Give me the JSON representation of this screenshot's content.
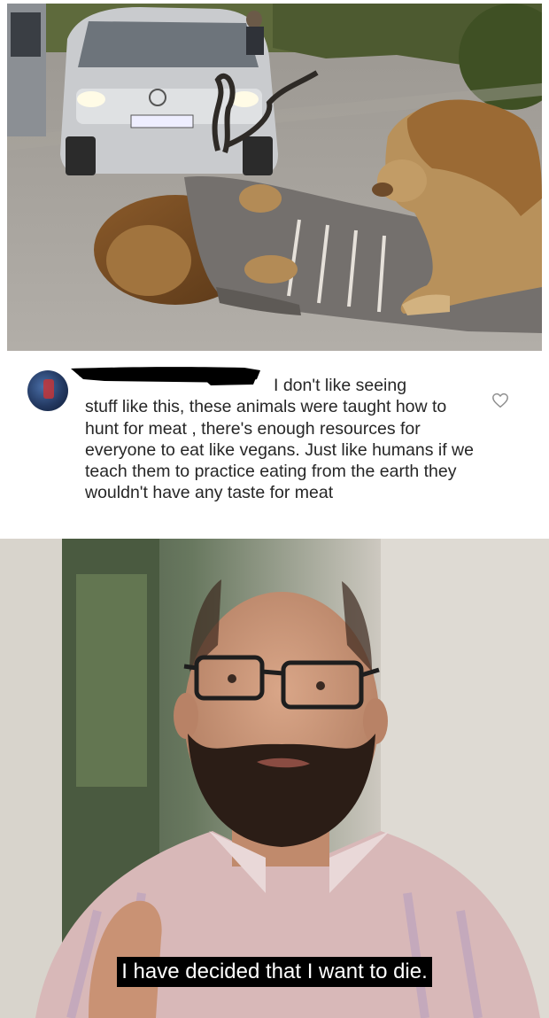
{
  "comment": {
    "text_line1": "I don't like seeing",
    "text_rest": "stuff like this, these animals were taught how to hunt for meat , there's enough resources for everyone to eat like vegans. Just like humans if we teach them to practice eating from the earth they wouldn't have any taste for meat"
  },
  "subtitle": {
    "text": "I have decided that I want to die."
  }
}
